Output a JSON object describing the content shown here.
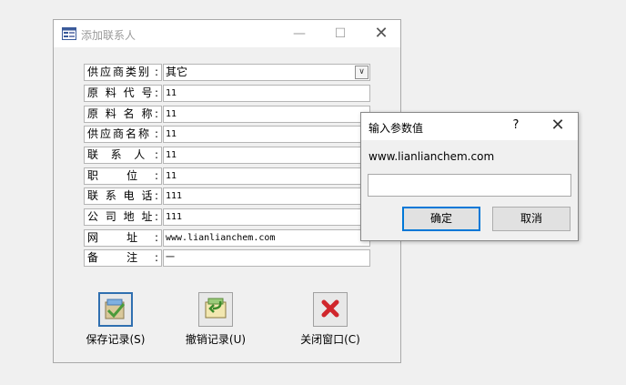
{
  "window": {
    "title": "添加联系人",
    "controls": {
      "minimize": "—",
      "maximize": "☐",
      "close": "✕"
    }
  },
  "form": {
    "rows": [
      {
        "label": "供应商类别",
        "value": "其它",
        "type": "select"
      },
      {
        "label": "原 料 代 号",
        "value": "11",
        "type": "text"
      },
      {
        "label": "原 料 名 称",
        "value": "11",
        "type": "text"
      },
      {
        "label": "供应商名称",
        "value": "11",
        "type": "text"
      },
      {
        "label": "联  系  人",
        "value": "11",
        "type": "text"
      },
      {
        "label": "职     位",
        "value": "11",
        "type": "text"
      },
      {
        "label": "联 系 电 话",
        "value": "111",
        "type": "text"
      },
      {
        "label": "公 司 地 址",
        "value": "111",
        "type": "text"
      },
      {
        "label": "网     址",
        "value": "www.lianlianchem.com",
        "type": "text"
      },
      {
        "label": "备     注",
        "value": "一",
        "type": "text"
      }
    ],
    "colon": ":"
  },
  "actions": [
    {
      "label": "保存记录(S)",
      "icon": "save-record-icon"
    },
    {
      "label": "撤销记录(U)",
      "icon": "undo-record-icon"
    },
    {
      "label": "关闭窗口(C)",
      "icon": "close-window-icon"
    }
  ],
  "dialog": {
    "title": "输入参数值",
    "help": "?",
    "close": "✕",
    "prompt": "www.lianlianchem.com",
    "input_value": "",
    "ok_label": "确定",
    "cancel_label": "取消"
  },
  "colors": {
    "accent": "#0078d7",
    "close_red": "#d0262c"
  }
}
